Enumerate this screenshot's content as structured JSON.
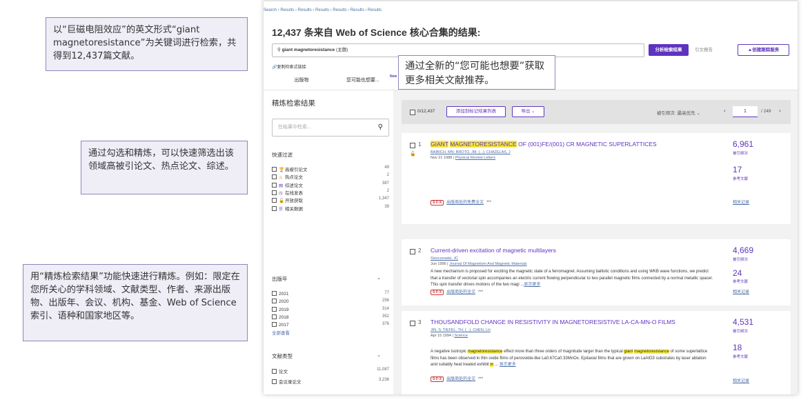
{
  "callouts": {
    "keyword_search": "以“巨磁电阻效应”的英文形式“giant magnetoresistance”为关键词进行检索，共得到12,437篇文献。",
    "quick_filter": "通过勾选和精炼，可以快速筛选出该领域高被引论文、热点论文、综述。",
    "refine": "用“精炼检索结果”功能快速进行精炼。例如：限定在您所关心的学科领域、文献类型、作者、来源出版物、出版年、会议、机构、基金、Web of Science索引、语种和国家地区等。",
    "you_may_like": "通过全新的“您可能也想要”获取更多相关文献推荐。"
  },
  "breadcrumb": "Search › Results › Results › Results › Results › Results › Results",
  "results_title": "12,437 条来自 Web of Science 核心合集的结果:",
  "search": {
    "query": "giant magnetoresistance",
    "field": "(主题)"
  },
  "buttons": {
    "analyze": "分析检索结果",
    "citation_report": "引文报告",
    "create_alert": "创建跟踪服务",
    "copy_link": "复制检索式链接"
  },
  "tabs": {
    "publications": "出版物",
    "you_may_like": "您可能也想要...",
    "new_badge": "New"
  },
  "refine": {
    "title": "精炼检索结果",
    "search_placeholder": "在结果中检索...",
    "quick_filters_title": "快速过滤",
    "quick_filters": [
      {
        "icon": "trophy-icon",
        "glyph": "🏆",
        "color": "#c0392b",
        "label": "高被引论文",
        "count": "49"
      },
      {
        "icon": "fire-icon",
        "glyph": "♨",
        "color": "#d35400",
        "label": "热点论文",
        "count": "2"
      },
      {
        "icon": "review-icon",
        "glyph": "▤",
        "color": "#5e33bf",
        "label": "综述论文",
        "count": "387"
      },
      {
        "icon": "clock-icon",
        "glyph": "◷",
        "color": "#5e33bf",
        "label": "在线发表",
        "count": "2"
      },
      {
        "icon": "open-lock-icon",
        "glyph": "🔓",
        "color": "#5e33bf",
        "label": "开放获取",
        "count": "1,347"
      },
      {
        "icon": "database-icon",
        "glyph": "☰",
        "color": "#5e33bf",
        "label": "相关数据",
        "count": "39"
      }
    ],
    "pub_year_title": "出版年",
    "pub_years": [
      {
        "label": "2021",
        "count": "77"
      },
      {
        "label": "2020",
        "count": "256"
      },
      {
        "label": "2019",
        "count": "314"
      },
      {
        "label": "2018",
        "count": "352"
      },
      {
        "label": "2017",
        "count": "376"
      }
    ],
    "see_all": "全部查看",
    "doc_type_title": "文献类型",
    "doc_types": [
      {
        "label": "论文",
        "count": "11,087"
      },
      {
        "label": "会议录论文",
        "count": "3,236"
      }
    ]
  },
  "toolbar": {
    "selected": "0/12,437",
    "add_to_list": "添加到标记结果列表",
    "export": "导出",
    "sort": "被引频次: 最高优先",
    "page": "1",
    "total_pages": "/ 249"
  },
  "records": [
    {
      "num": "1",
      "title_hl": [
        "GIANT",
        "MAGNETORESISTANCE"
      ],
      "title_rest": "OF (001)FE/(001) CR MAGNETIC SUPERLATTICES",
      "authors": "BAIBICH, MN; BROTO, JM; (...); CHAZELAS, J",
      "date": "Nov 21 1988",
      "journal": "Physical Review Letters",
      "abstract": "",
      "more": "",
      "link": "出版商处的免费全文",
      "cites": "6,961",
      "cites_label": "被引频次",
      "refs": "17",
      "refs_label": "参考文献",
      "related": "相关记录"
    },
    {
      "num": "2",
      "title": "Current-driven excitation of magnetic multilayers",
      "authors": "Slonczewski, JC",
      "date": "Jun 1996",
      "journal": "Journal Of Magnetism And Magnetic Materials",
      "abstract": "A new mechanism is proposed for exciting the magnetic state of a ferromagnet. Assuming ballistic conditions and using WKB wave functions, we predict that a transfer of vectorial spin accompanies an electric current flowing perpendicular to two parallel magnetic films connected by a normal metallic spacer. This spin transfer drives motions of the two magi ...",
      "more": "显示更多",
      "link": "出版商处的全文",
      "cites": "4,669",
      "cites_label": "被引频次",
      "refs": "24",
      "refs_label": "参考文献",
      "related": "相关记录"
    },
    {
      "num": "3",
      "title": "THOUSANDFOLD CHANGE IN RESISTIVITY IN MAGNETORESISTIVE LA-CA-MN-O FILMS",
      "authors": "JIN, S; TIEFEL, TH; (...); CHEN, LH",
      "date": "Apr 15 1994",
      "journal": "Science",
      "abstract_parts": [
        "A negative isotropic ",
        "magnetoresistance",
        " effect more than three orders of magnitude larger than the typical ",
        "giant",
        " ",
        "magnetoresistance",
        " of some superlattice films has been observed in thin oxide films of perovskite-like La0.67Ca0.33MnOx. Epitaxial films that are grown on LaAlO3 substrates by laser ablation and suitably heat treated exhibit ",
        "m",
        " ... "
      ],
      "more": "显示更多",
      "link": "出版商处的全文",
      "cites": "4,531",
      "cites_label": "被引频次",
      "refs": "18",
      "refs_label": "参考文献",
      "related": "相关记录"
    }
  ],
  "sfx_label": "S·F·X",
  "dots": "***"
}
